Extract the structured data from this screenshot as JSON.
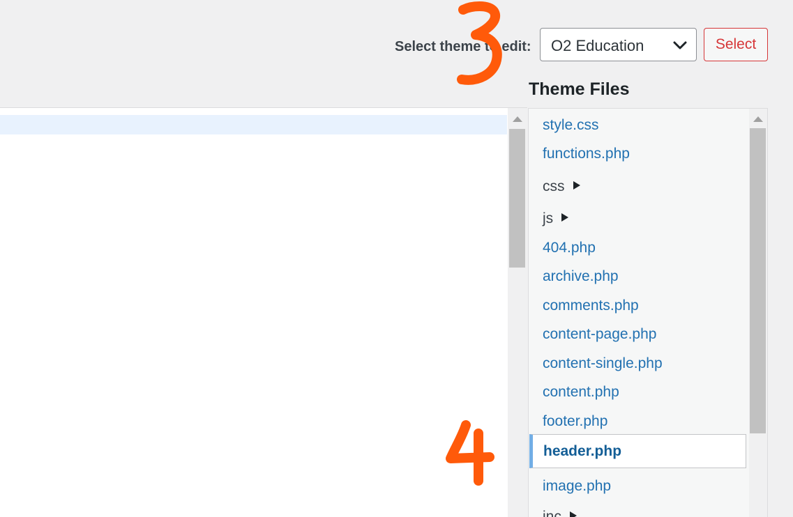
{
  "theme_selector": {
    "label": "Select theme to edit:",
    "selected_value": "O2 Education",
    "select_button": "Select"
  },
  "files_heading": "Theme Files",
  "file_list": {
    "items": [
      {
        "label": "style.css",
        "kind": "file"
      },
      {
        "label": "functions.php",
        "kind": "file"
      },
      {
        "label": "css",
        "kind": "folder"
      },
      {
        "label": "js",
        "kind": "folder"
      },
      {
        "label": "404.php",
        "kind": "file"
      },
      {
        "label": "archive.php",
        "kind": "file"
      },
      {
        "label": "comments.php",
        "kind": "file"
      },
      {
        "label": "content-page.php",
        "kind": "file"
      },
      {
        "label": "content-single.php",
        "kind": "file"
      },
      {
        "label": "content.php",
        "kind": "file"
      },
      {
        "label": "footer.php",
        "kind": "file"
      },
      {
        "label": "header.php",
        "kind": "file",
        "selected": true
      },
      {
        "label": "image.php",
        "kind": "file"
      },
      {
        "label": "inc",
        "kind": "folder"
      }
    ]
  },
  "annotations": {
    "step_3": "3",
    "step_4": "4",
    "color": "#ff5a0a"
  },
  "colors": {
    "link": "#2271b1",
    "selected_border": "#72aee6",
    "button_danger": "#d63638",
    "active_line": "#e8f2fe"
  }
}
